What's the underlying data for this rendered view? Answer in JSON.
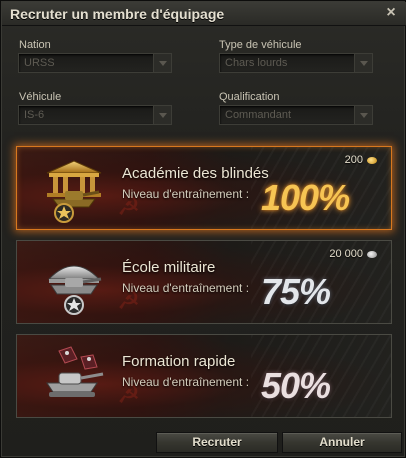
{
  "window": {
    "title": "Recruter un membre d'équipage",
    "close_icon": "×"
  },
  "filters": {
    "nation": {
      "label": "Nation",
      "value": "URSS"
    },
    "vehicle_type": {
      "label": "Type de véhicule",
      "value": "Chars lourds"
    },
    "vehicle": {
      "label": "Véhicule",
      "value": "IS-6"
    },
    "qualification": {
      "label": "Qualification",
      "value": "Commandant"
    }
  },
  "options": [
    {
      "name": "Académie des blindés",
      "level_label": "Niveau d'entraînement :",
      "percent": "100%",
      "cost": "200",
      "currency": "gold",
      "selected": true
    },
    {
      "name": "École militaire",
      "level_label": "Niveau d'entraînement :",
      "percent": "75%",
      "cost": "20 000",
      "currency": "silver",
      "selected": false
    },
    {
      "name": "Formation rapide",
      "level_label": "Niveau d'entraînement :",
      "percent": "50%",
      "cost": "",
      "currency": "",
      "selected": false
    }
  ],
  "buttons": {
    "recruit": "Recruter",
    "cancel": "Annuler"
  },
  "colors": {
    "selected_glow": "#d8781e",
    "gold_text": "#f6c453",
    "background": "#232320"
  }
}
